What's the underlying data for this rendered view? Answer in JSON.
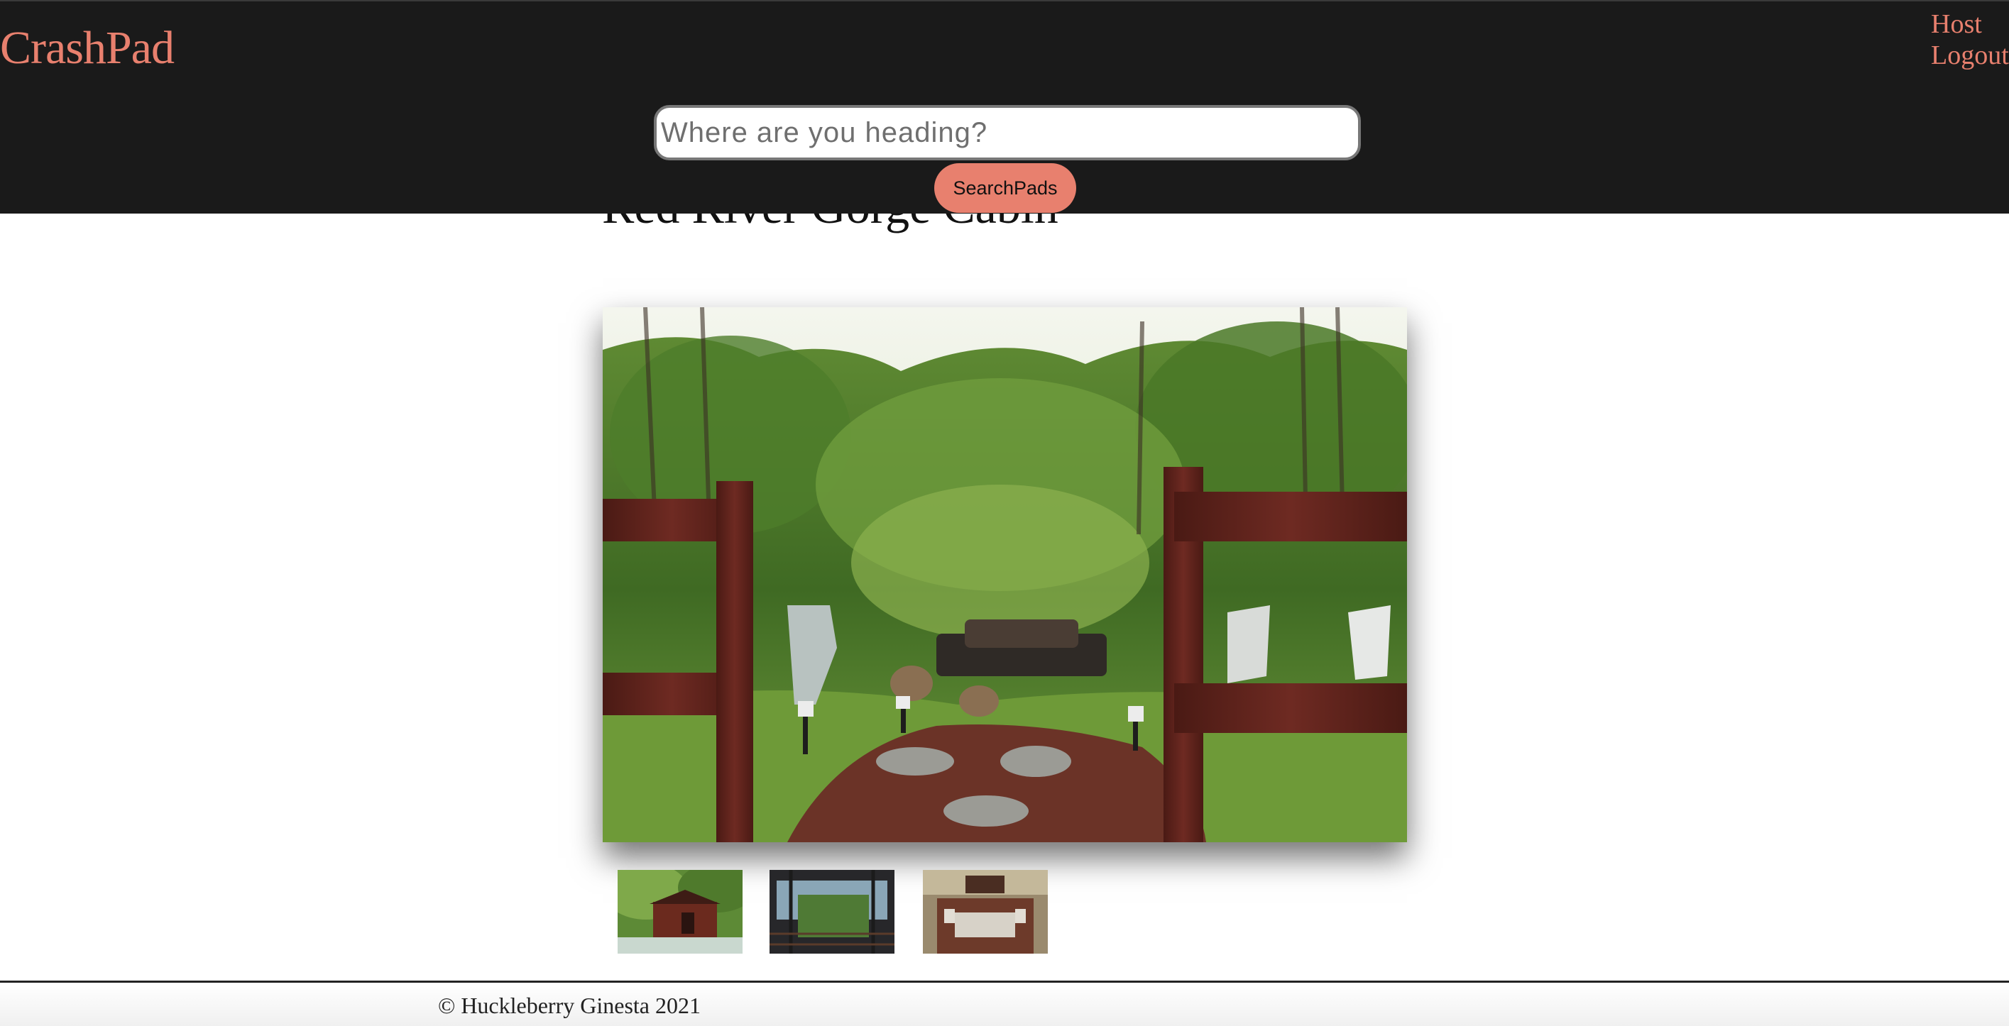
{
  "header": {
    "logo": "CrashPad",
    "nav": {
      "host": "Host",
      "logout": "Logout"
    },
    "search": {
      "placeholder": "Where are you heading?",
      "value": "",
      "button_label": "SearchPads"
    }
  },
  "listing": {
    "title": "Red River Gorge Cabin",
    "main_photo": "cabin-fire-pit-photo",
    "thumbnails": [
      "cabin-exterior-thumbnail",
      "covered-porch-thumbnail",
      "deck-furniture-thumbnail"
    ]
  },
  "footer": {
    "copyright": "© Huckleberry Ginesta 2021"
  },
  "colors": {
    "header_bg": "#1a1a1a",
    "accent": "#e8806e",
    "page_bg": "#ffffff"
  }
}
